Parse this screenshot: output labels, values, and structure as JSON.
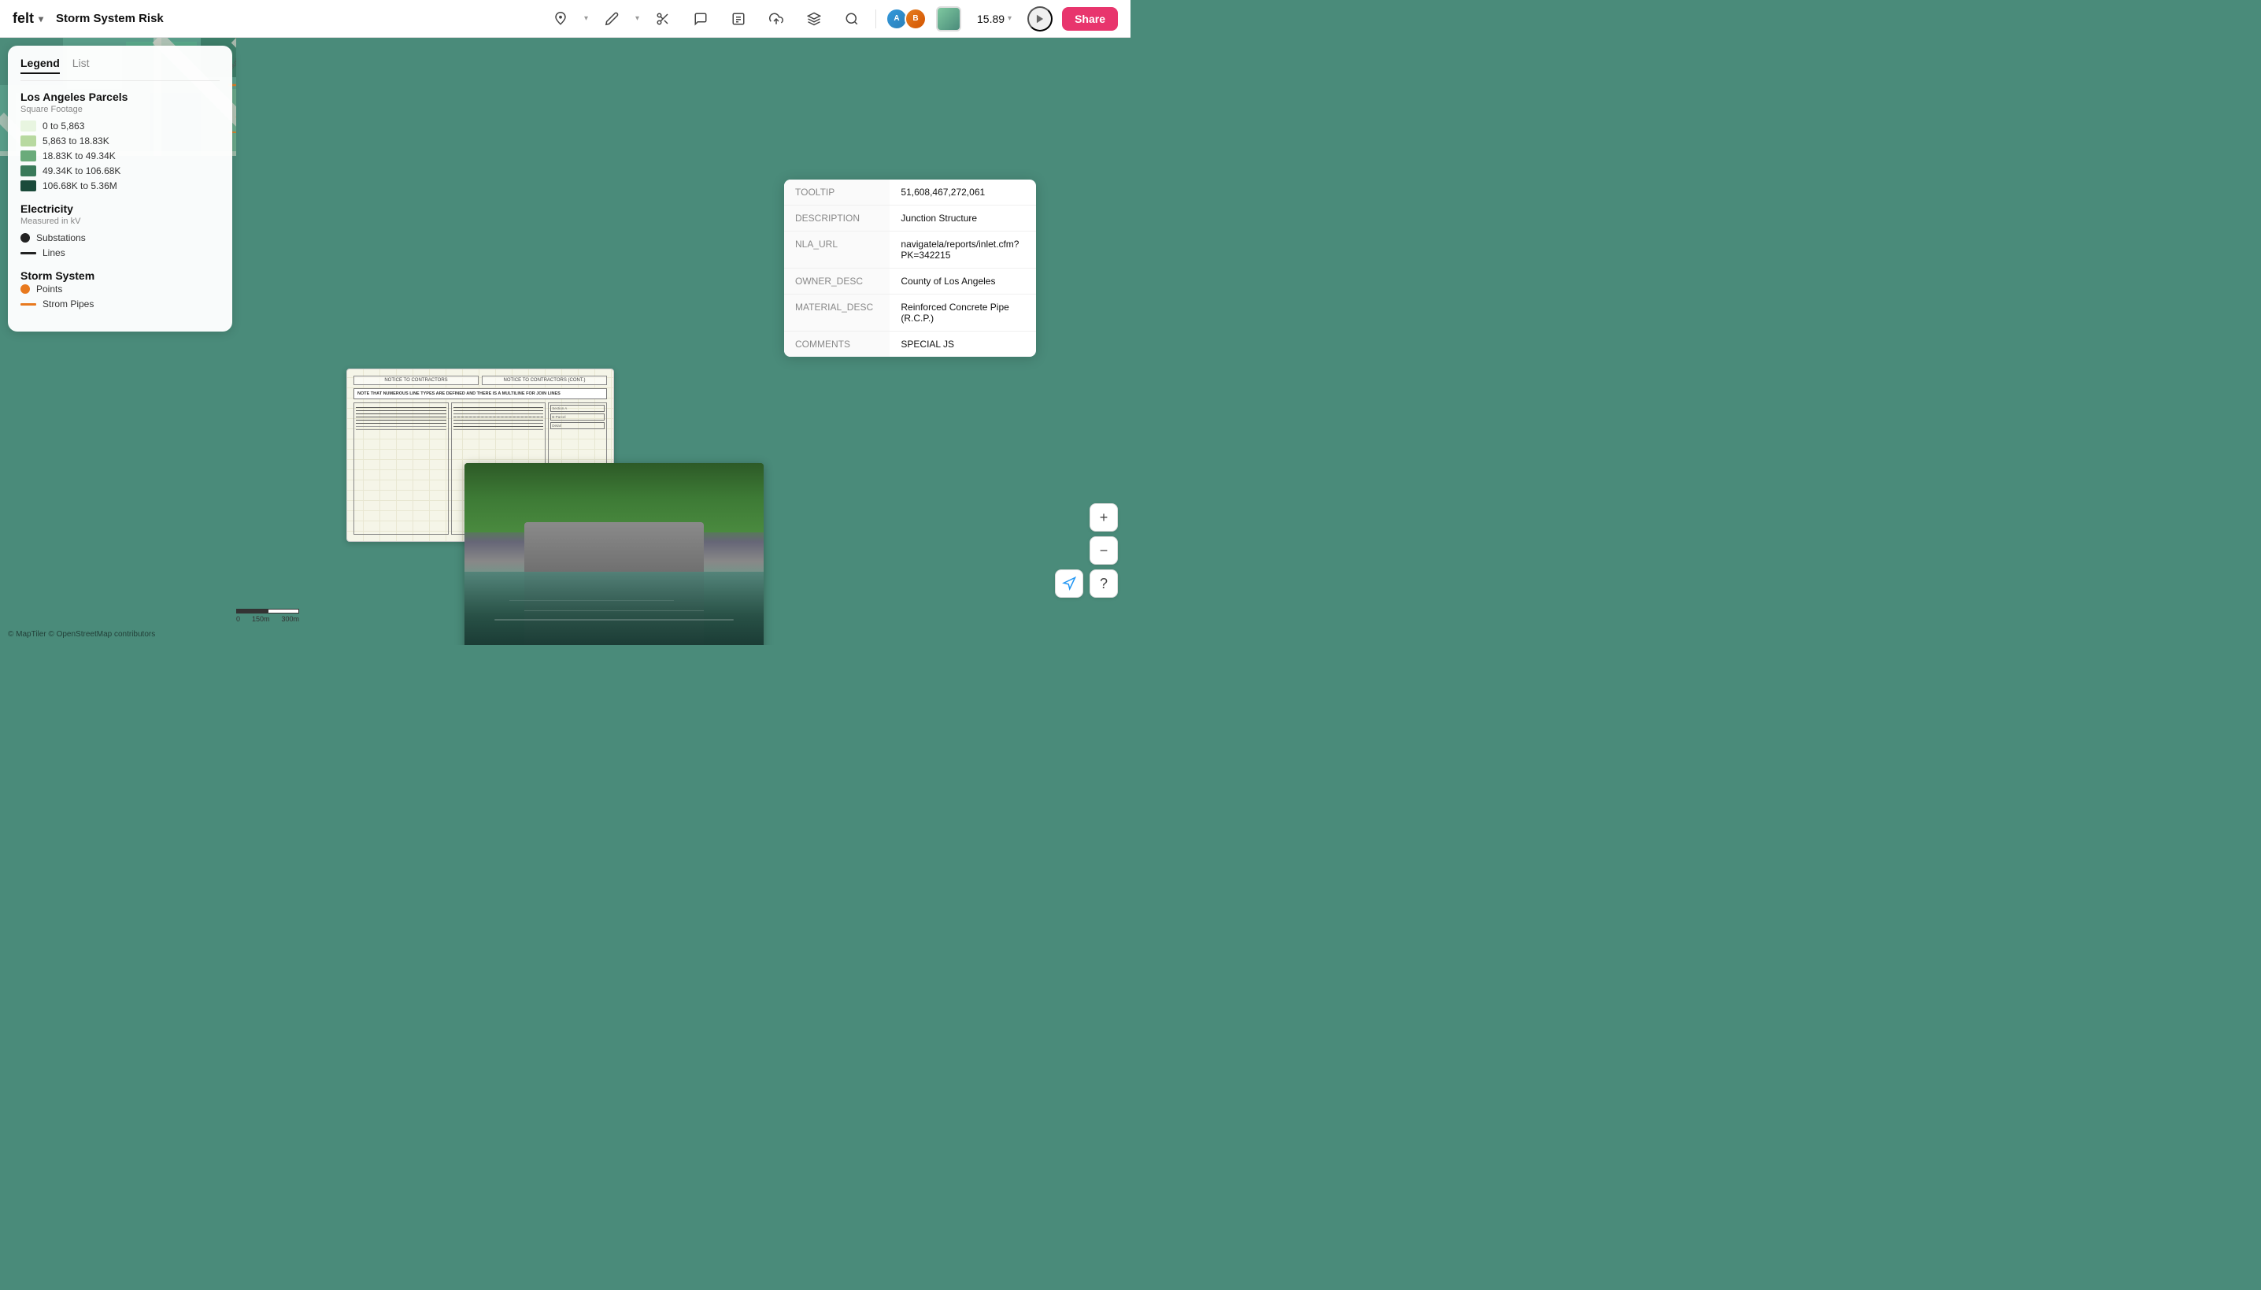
{
  "app": {
    "logo": "felt",
    "title": "Storm System Risk",
    "zoom": "15.89"
  },
  "navbar": {
    "tabs": [
      "Legend",
      "List"
    ],
    "active_tab": "Legend",
    "share_label": "Share",
    "zoom_label": "15.89"
  },
  "legend": {
    "title": "Legend",
    "list_label": "List",
    "sections": [
      {
        "name": "Los Angeles Parcels",
        "subtitle": "Square Footage",
        "items": [
          {
            "label": "0 to 5,863",
            "color": "#e8f5e0"
          },
          {
            "label": "5,863 to 18.83K",
            "color": "#b8d9a0"
          },
          {
            "label": "18.83K to 49.34K",
            "color": "#6aab7a"
          },
          {
            "label": "49.34K to 106.68K",
            "color": "#3a7a5a"
          },
          {
            "label": "106.68K to 5.36M",
            "color": "#1a4a3a"
          }
        ]
      },
      {
        "name": "Electricity",
        "subtitle": "Measured in kV",
        "items": [
          {
            "type": "dot",
            "label": "Substations",
            "color": "#222222"
          },
          {
            "type": "line",
            "label": "Lines",
            "color": "#222222"
          }
        ]
      },
      {
        "name": "Storm System",
        "items": [
          {
            "type": "dot",
            "label": "Points",
            "color": "#e8791e"
          },
          {
            "type": "line",
            "label": "Strom Pipes",
            "color": "#e8791e"
          }
        ]
      }
    ]
  },
  "info_panel": {
    "rows": [
      {
        "key": "TOOLTIP",
        "value": "51,608,467,272,061"
      },
      {
        "key": "DESCRIPTION",
        "value": "Junction Structure"
      },
      {
        "key": "NLA_URL",
        "value": "navigatela/reports/inlet.cfm?PK=342215"
      },
      {
        "key": "OWNER_DESC",
        "value": "County of Los Angeles"
      },
      {
        "key": "MATERIAL_DESC",
        "value": "Reinforced Concrete Pipe (R.C.P.)"
      },
      {
        "key": "COMMENTS",
        "value": "SPECIAL JS"
      }
    ]
  },
  "map": {
    "attribution": "© MapTiler  © OpenStreetMap contributors",
    "scale_labels": [
      "0",
      "150m",
      "300m"
    ]
  },
  "controls": {
    "zoom_in": "+",
    "zoom_out": "−",
    "help": "?",
    "location": "◎"
  },
  "blueprint": {
    "header1": "NOTICE TO CONTRACTORS",
    "header2": "NOTICE TO CONTRACTORS (CONT.)",
    "note": "NOTE THAT NUMEROUS LINE TYPES ARE DEFINED AND THERE IS A MULTILINE FOR JOIN LINES"
  }
}
